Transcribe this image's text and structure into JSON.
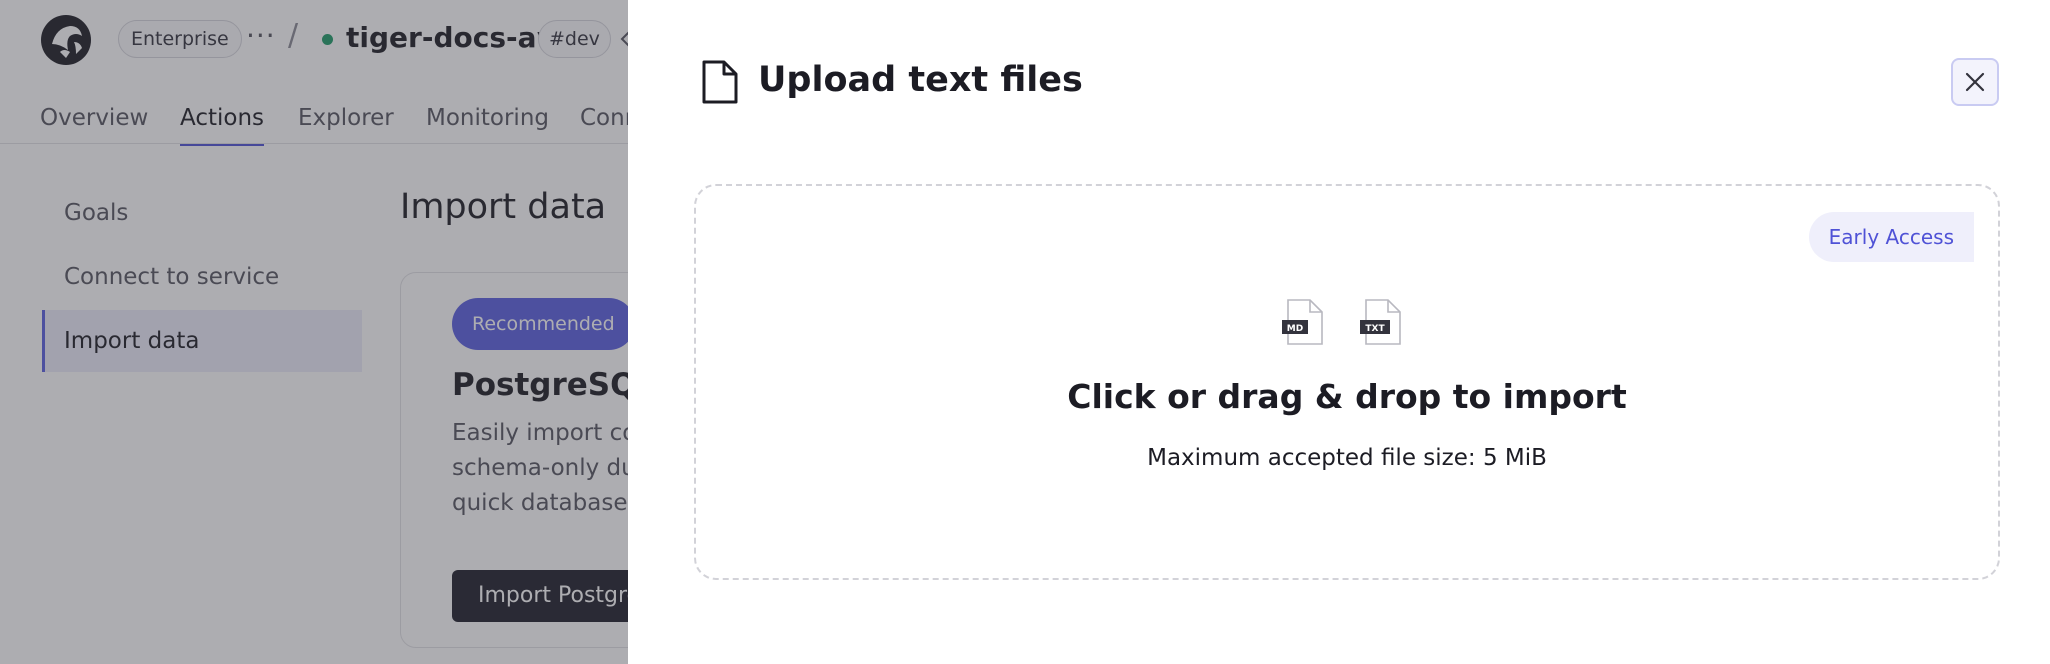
{
  "topbar": {
    "plan_badge": "Enterprise",
    "more": "···",
    "separator": "/",
    "service_name": "tiger-docs-aws",
    "env_badge": "#dev",
    "status_color": "#1e9c68"
  },
  "nav": {
    "tabs": [
      {
        "label": "Overview"
      },
      {
        "label": "Actions"
      },
      {
        "label": "Explorer"
      },
      {
        "label": "Monitoring"
      },
      {
        "label": "Conn"
      }
    ]
  },
  "sidebar": {
    "items": [
      {
        "label": "Goals"
      },
      {
        "label": "Connect to service"
      },
      {
        "label": "Import data"
      }
    ]
  },
  "main": {
    "title": "Import data",
    "card": {
      "badge": "Recommended",
      "title": "PostgreSQL I",
      "desc_lines": [
        "Easily import con",
        "schema-only dur",
        "quick database a"
      ],
      "button": "Import Postgre"
    }
  },
  "drawer": {
    "title": "Upload text files",
    "dropzone": {
      "badge": "Early Access",
      "file_types": [
        "MD",
        "TXT"
      ],
      "title": "Click or drag & drop to import",
      "subtitle": "Maximum accepted file size: 5 MiB"
    }
  },
  "colors": {
    "accent": "#5b5fe0",
    "dark_button": "#1e1e2a",
    "overlay": "rgba(60,60,68,0.42)"
  },
  "icons": {
    "logo": "tiger-logo-icon",
    "service": "service-icon",
    "drawer": "file-icon",
    "close": "close-icon"
  }
}
